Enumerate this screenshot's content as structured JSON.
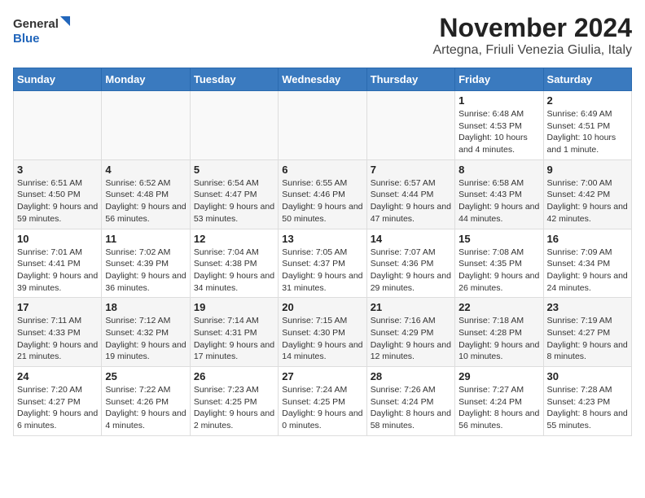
{
  "header": {
    "logo_general": "General",
    "logo_blue": "Blue",
    "title": "November 2024",
    "subtitle": "Artegna, Friuli Venezia Giulia, Italy"
  },
  "days_of_week": [
    "Sunday",
    "Monday",
    "Tuesday",
    "Wednesday",
    "Thursday",
    "Friday",
    "Saturday"
  ],
  "weeks": [
    [
      {
        "day": "",
        "sunrise": "",
        "sunset": "",
        "daylight": "",
        "empty": true
      },
      {
        "day": "",
        "sunrise": "",
        "sunset": "",
        "daylight": "",
        "empty": true
      },
      {
        "day": "",
        "sunrise": "",
        "sunset": "",
        "daylight": "",
        "empty": true
      },
      {
        "day": "",
        "sunrise": "",
        "sunset": "",
        "daylight": "",
        "empty": true
      },
      {
        "day": "",
        "sunrise": "",
        "sunset": "",
        "daylight": "",
        "empty": true
      },
      {
        "day": "1",
        "sunrise": "Sunrise: 6:48 AM",
        "sunset": "Sunset: 4:53 PM",
        "daylight": "Daylight: 10 hours and 4 minutes.",
        "empty": false
      },
      {
        "day": "2",
        "sunrise": "Sunrise: 6:49 AM",
        "sunset": "Sunset: 4:51 PM",
        "daylight": "Daylight: 10 hours and 1 minute.",
        "empty": false
      }
    ],
    [
      {
        "day": "3",
        "sunrise": "Sunrise: 6:51 AM",
        "sunset": "Sunset: 4:50 PM",
        "daylight": "Daylight: 9 hours and 59 minutes.",
        "empty": false
      },
      {
        "day": "4",
        "sunrise": "Sunrise: 6:52 AM",
        "sunset": "Sunset: 4:48 PM",
        "daylight": "Daylight: 9 hours and 56 minutes.",
        "empty": false
      },
      {
        "day": "5",
        "sunrise": "Sunrise: 6:54 AM",
        "sunset": "Sunset: 4:47 PM",
        "daylight": "Daylight: 9 hours and 53 minutes.",
        "empty": false
      },
      {
        "day": "6",
        "sunrise": "Sunrise: 6:55 AM",
        "sunset": "Sunset: 4:46 PM",
        "daylight": "Daylight: 9 hours and 50 minutes.",
        "empty": false
      },
      {
        "day": "7",
        "sunrise": "Sunrise: 6:57 AM",
        "sunset": "Sunset: 4:44 PM",
        "daylight": "Daylight: 9 hours and 47 minutes.",
        "empty": false
      },
      {
        "day": "8",
        "sunrise": "Sunrise: 6:58 AM",
        "sunset": "Sunset: 4:43 PM",
        "daylight": "Daylight: 9 hours and 44 minutes.",
        "empty": false
      },
      {
        "day": "9",
        "sunrise": "Sunrise: 7:00 AM",
        "sunset": "Sunset: 4:42 PM",
        "daylight": "Daylight: 9 hours and 42 minutes.",
        "empty": false
      }
    ],
    [
      {
        "day": "10",
        "sunrise": "Sunrise: 7:01 AM",
        "sunset": "Sunset: 4:41 PM",
        "daylight": "Daylight: 9 hours and 39 minutes.",
        "empty": false
      },
      {
        "day": "11",
        "sunrise": "Sunrise: 7:02 AM",
        "sunset": "Sunset: 4:39 PM",
        "daylight": "Daylight: 9 hours and 36 minutes.",
        "empty": false
      },
      {
        "day": "12",
        "sunrise": "Sunrise: 7:04 AM",
        "sunset": "Sunset: 4:38 PM",
        "daylight": "Daylight: 9 hours and 34 minutes.",
        "empty": false
      },
      {
        "day": "13",
        "sunrise": "Sunrise: 7:05 AM",
        "sunset": "Sunset: 4:37 PM",
        "daylight": "Daylight: 9 hours and 31 minutes.",
        "empty": false
      },
      {
        "day": "14",
        "sunrise": "Sunrise: 7:07 AM",
        "sunset": "Sunset: 4:36 PM",
        "daylight": "Daylight: 9 hours and 29 minutes.",
        "empty": false
      },
      {
        "day": "15",
        "sunrise": "Sunrise: 7:08 AM",
        "sunset": "Sunset: 4:35 PM",
        "daylight": "Daylight: 9 hours and 26 minutes.",
        "empty": false
      },
      {
        "day": "16",
        "sunrise": "Sunrise: 7:09 AM",
        "sunset": "Sunset: 4:34 PM",
        "daylight": "Daylight: 9 hours and 24 minutes.",
        "empty": false
      }
    ],
    [
      {
        "day": "17",
        "sunrise": "Sunrise: 7:11 AM",
        "sunset": "Sunset: 4:33 PM",
        "daylight": "Daylight: 9 hours and 21 minutes.",
        "empty": false
      },
      {
        "day": "18",
        "sunrise": "Sunrise: 7:12 AM",
        "sunset": "Sunset: 4:32 PM",
        "daylight": "Daylight: 9 hours and 19 minutes.",
        "empty": false
      },
      {
        "day": "19",
        "sunrise": "Sunrise: 7:14 AM",
        "sunset": "Sunset: 4:31 PM",
        "daylight": "Daylight: 9 hours and 17 minutes.",
        "empty": false
      },
      {
        "day": "20",
        "sunrise": "Sunrise: 7:15 AM",
        "sunset": "Sunset: 4:30 PM",
        "daylight": "Daylight: 9 hours and 14 minutes.",
        "empty": false
      },
      {
        "day": "21",
        "sunrise": "Sunrise: 7:16 AM",
        "sunset": "Sunset: 4:29 PM",
        "daylight": "Daylight: 9 hours and 12 minutes.",
        "empty": false
      },
      {
        "day": "22",
        "sunrise": "Sunrise: 7:18 AM",
        "sunset": "Sunset: 4:28 PM",
        "daylight": "Daylight: 9 hours and 10 minutes.",
        "empty": false
      },
      {
        "day": "23",
        "sunrise": "Sunrise: 7:19 AM",
        "sunset": "Sunset: 4:27 PM",
        "daylight": "Daylight: 9 hours and 8 minutes.",
        "empty": false
      }
    ],
    [
      {
        "day": "24",
        "sunrise": "Sunrise: 7:20 AM",
        "sunset": "Sunset: 4:27 PM",
        "daylight": "Daylight: 9 hours and 6 minutes.",
        "empty": false
      },
      {
        "day": "25",
        "sunrise": "Sunrise: 7:22 AM",
        "sunset": "Sunset: 4:26 PM",
        "daylight": "Daylight: 9 hours and 4 minutes.",
        "empty": false
      },
      {
        "day": "26",
        "sunrise": "Sunrise: 7:23 AM",
        "sunset": "Sunset: 4:25 PM",
        "daylight": "Daylight: 9 hours and 2 minutes.",
        "empty": false
      },
      {
        "day": "27",
        "sunrise": "Sunrise: 7:24 AM",
        "sunset": "Sunset: 4:25 PM",
        "daylight": "Daylight: 9 hours and 0 minutes.",
        "empty": false
      },
      {
        "day": "28",
        "sunrise": "Sunrise: 7:26 AM",
        "sunset": "Sunset: 4:24 PM",
        "daylight": "Daylight: 8 hours and 58 minutes.",
        "empty": false
      },
      {
        "day": "29",
        "sunrise": "Sunrise: 7:27 AM",
        "sunset": "Sunset: 4:24 PM",
        "daylight": "Daylight: 8 hours and 56 minutes.",
        "empty": false
      },
      {
        "day": "30",
        "sunrise": "Sunrise: 7:28 AM",
        "sunset": "Sunset: 4:23 PM",
        "daylight": "Daylight: 8 hours and 55 minutes.",
        "empty": false
      }
    ]
  ]
}
